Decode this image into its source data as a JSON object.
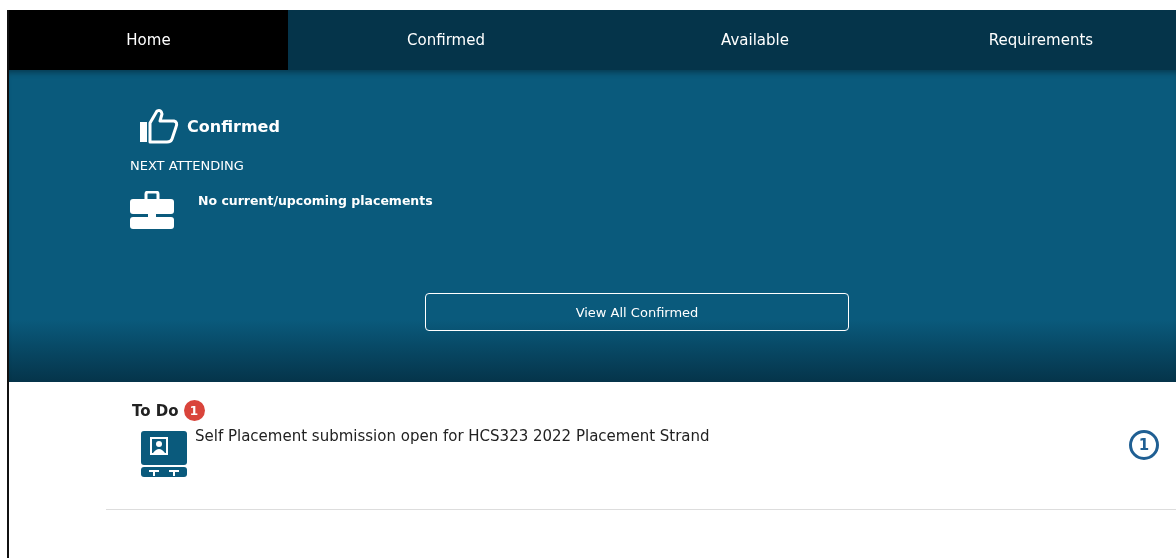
{
  "tabs": [
    {
      "label": "Home",
      "selected": true
    },
    {
      "label": "Confirmed",
      "selected": false
    },
    {
      "label": "Available",
      "selected": false
    },
    {
      "label": "Requirements",
      "selected": false
    }
  ],
  "confirmed": {
    "title": "Confirmed",
    "subtitle": "NEXT ATTENDING",
    "message": "No current/upcoming placements",
    "button": "View All Confirmed"
  },
  "todo": {
    "title": "To Do",
    "count": "1",
    "items": [
      {
        "text": "Self Placement submission open for HCS323 2022 Placement Strand",
        "count": "1"
      }
    ]
  }
}
